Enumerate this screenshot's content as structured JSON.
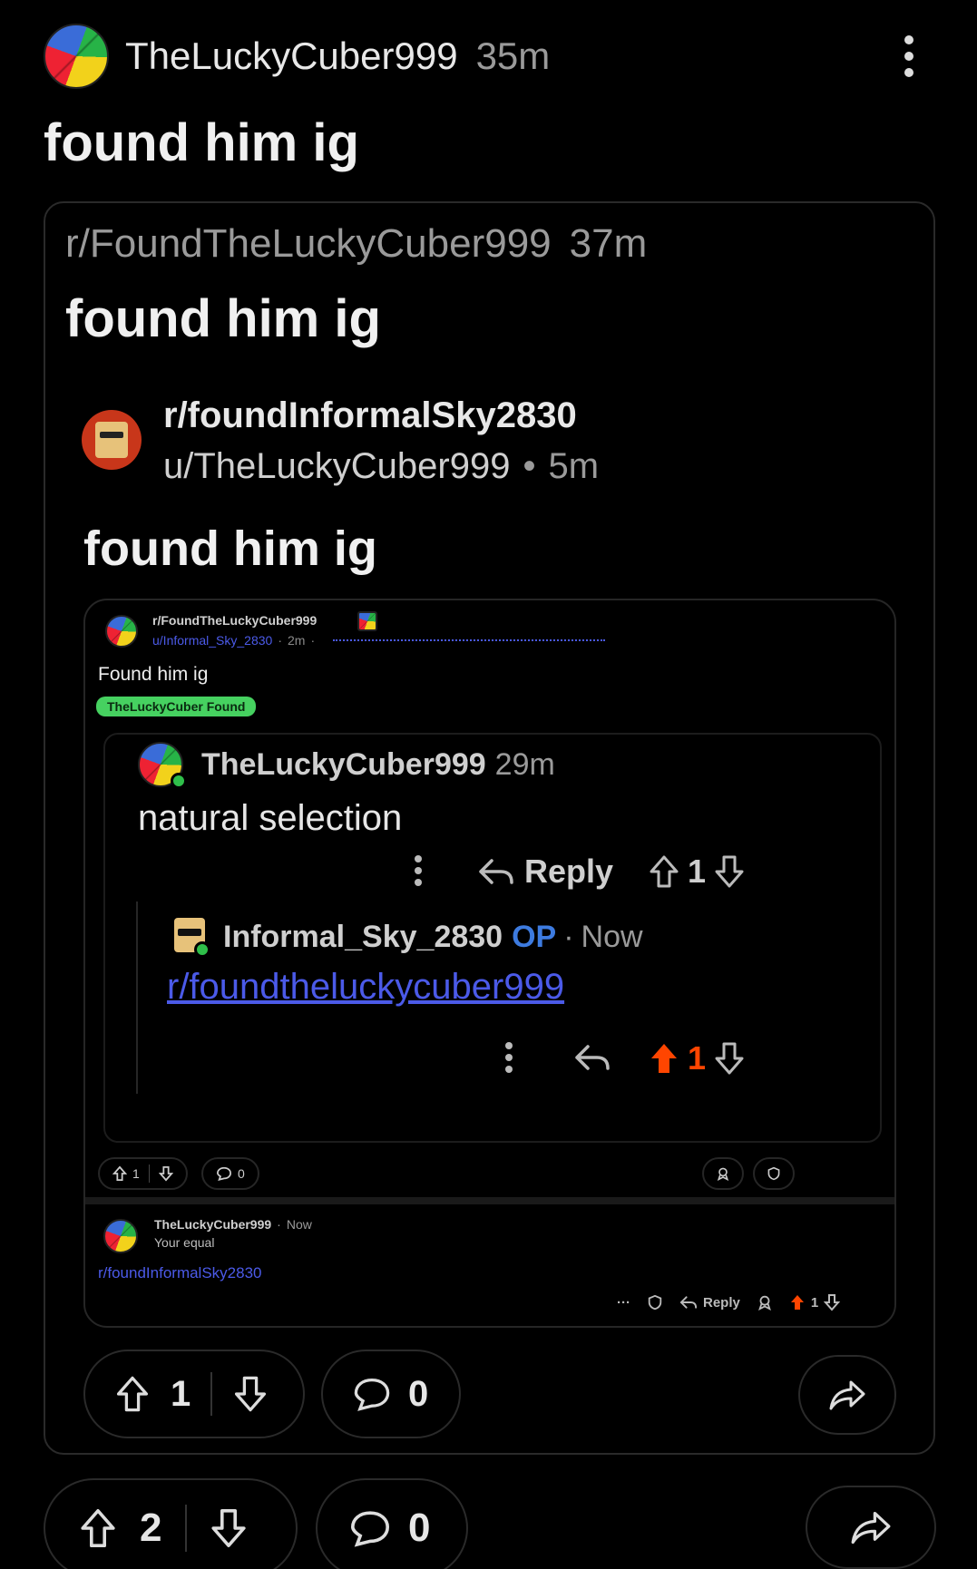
{
  "post": {
    "author": "TheLuckyCuber999",
    "time": "35m",
    "title": "found him ig",
    "upvotes": "2",
    "comments": "0"
  },
  "crosspost": {
    "subreddit": "r/FoundTheLuckyCuber999",
    "time": "37m",
    "title": "found him ig",
    "upvotes": "1",
    "comments": "0",
    "inner": {
      "subreddit": "r/foundInformalSky2830",
      "user": "u/TheLuckyCuber999",
      "time": "5m",
      "title": "found him ig"
    }
  },
  "screenshot": {
    "subreddit": "r/FoundTheLuckyCuber999",
    "user": "u/Informal_Sky_2830",
    "time": "2m",
    "title": "Found him ig",
    "flair": "TheLuckyCuber Found",
    "comment1": {
      "author": "TheLuckyCuber999",
      "time": "29m",
      "text": "natural selection",
      "reply": "Reply",
      "votes": "1"
    },
    "comment2": {
      "author": "Informal_Sky_2830",
      "op": "OP",
      "time": "Now",
      "link": "r/foundtheluckycuber999",
      "votes": "1"
    },
    "bar": {
      "votes": "1",
      "comments": "0"
    },
    "comment3": {
      "author": "TheLuckyCuber999",
      "time": "Now",
      "text": "Your equal",
      "link": "r/foundInformalSky2830",
      "more": "···",
      "reply": "Reply",
      "votes": "1"
    }
  },
  "colors": {
    "accent_orange": "#ff4500",
    "link_blue": "#4b5ae8",
    "flair_green": "#46d160",
    "op_blue": "#3d7be0"
  }
}
